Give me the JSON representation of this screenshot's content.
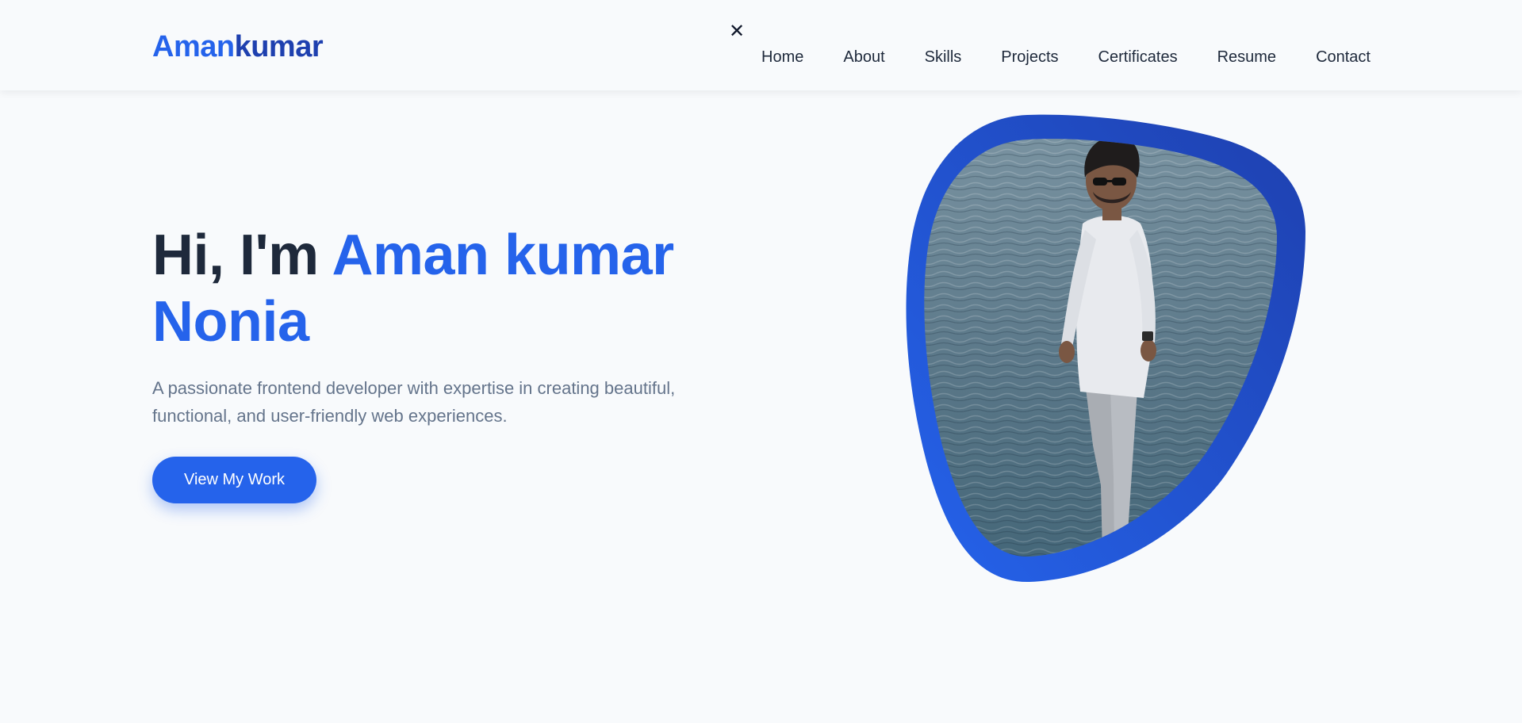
{
  "brand": {
    "first": "Aman",
    "second": "kumar",
    "colors": {
      "first": "#2563eb",
      "second": "#1e40af"
    }
  },
  "nav": {
    "close_icon": "close-icon",
    "close_glyph": "✕",
    "links": [
      "Home",
      "About",
      "Skills",
      "Projects",
      "Certificates",
      "Resume",
      "Contact"
    ]
  },
  "hero": {
    "greeting": "Hi, I'm ",
    "name_line1": "Aman kumar",
    "name_line2": "Nonia",
    "description": "A passionate frontend developer with expertise in creating beautiful, functional, and user-friendly web experiences.",
    "cta_label": "View My Work"
  },
  "profile_image": {
    "subject": "profile-photo",
    "frame_color": "#2563eb"
  }
}
